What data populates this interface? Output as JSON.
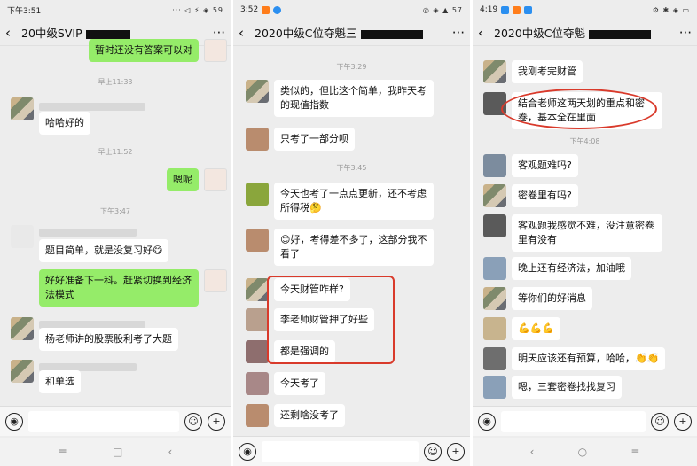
{
  "panels": [
    {
      "status_time": "下午3:51",
      "status_right": "··· ◁ ⚡ ◈ 59",
      "title": "20中级SVIP",
      "more": "···",
      "messages": [
        {
          "text": "暂时还没有答案可以对",
          "side": "right"
        },
        {
          "time": "早上11:33"
        },
        {
          "text": "哈哈好的",
          "side": "left"
        },
        {
          "time": "早上11:52"
        },
        {
          "text": "嗯呢",
          "side": "right"
        },
        {
          "time": "下午3:47"
        },
        {
          "text": "题目简单，就是没复习好😋",
          "side": "left"
        },
        {
          "text": "好好准备下一科。赶紧切换到经济法模式",
          "side": "right"
        },
        {
          "text": "杨老师讲的股票股利考了大题",
          "side": "left"
        },
        {
          "text": "和单选",
          "side": "left"
        }
      ],
      "nav": [
        "≡",
        "□",
        "‹"
      ]
    },
    {
      "status_time": "3:52",
      "status_right": "◎ ◈ ▲ 57",
      "title": "2020中级C位夺魁三",
      "more": "···",
      "messages": [
        {
          "time": "下午3:29"
        },
        {
          "text": "类似的，但比这个简单，我昨天考的现值指数",
          "side": "left"
        },
        {
          "text": "只考了一部分呗",
          "side": "left"
        },
        {
          "time": "下午3:45"
        },
        {
          "text": "今天也考了一点点更新，还不考虑所得税🤔",
          "side": "left"
        },
        {
          "text": "😊好，考得差不多了，这部分我不看了",
          "side": "left"
        },
        {
          "text": "今天财管咋样?",
          "side": "left"
        },
        {
          "text": "李老师财管押了好些",
          "side": "left"
        },
        {
          "text": "都是强调的",
          "side": "left"
        },
        {
          "text": "今天考了",
          "side": "left"
        },
        {
          "text": "还剩啥没考了",
          "side": "left"
        }
      ]
    },
    {
      "status_time": "4:19",
      "status_right": "⚙ ✱ ◈ ▭",
      "title": "2020中级C位夺魁",
      "more": "···",
      "messages": [
        {
          "text": "我刚考完财管",
          "side": "left"
        },
        {
          "text": "结合老师这两天划的重点和密卷，基本全在里面",
          "side": "left"
        },
        {
          "time": "下午4:08"
        },
        {
          "text": "客观题难吗?",
          "side": "left"
        },
        {
          "text": "密卷里有吗?",
          "side": "left"
        },
        {
          "text": "客观题我感觉不难，没注意密卷里有没有",
          "side": "left"
        },
        {
          "text": "晚上还有经济法，加油哦",
          "side": "left"
        },
        {
          "text": "等你们的好消息",
          "side": "left"
        },
        {
          "text": "💪💪💪",
          "side": "left"
        },
        {
          "text": "明天应该还有预算，哈哈，👏👏",
          "side": "left"
        },
        {
          "text": "嗯，三套密卷找找复习",
          "side": "left"
        }
      ],
      "nav": [
        "‹",
        "○",
        "≡"
      ]
    }
  ],
  "colors": {
    "bubble_green": "#95ec69",
    "highlight": "#d93a2b",
    "bg": "#ededed"
  },
  "icons": {
    "voice": "voice-icon",
    "emoji": "emoji-icon",
    "plus": "plus-icon"
  }
}
